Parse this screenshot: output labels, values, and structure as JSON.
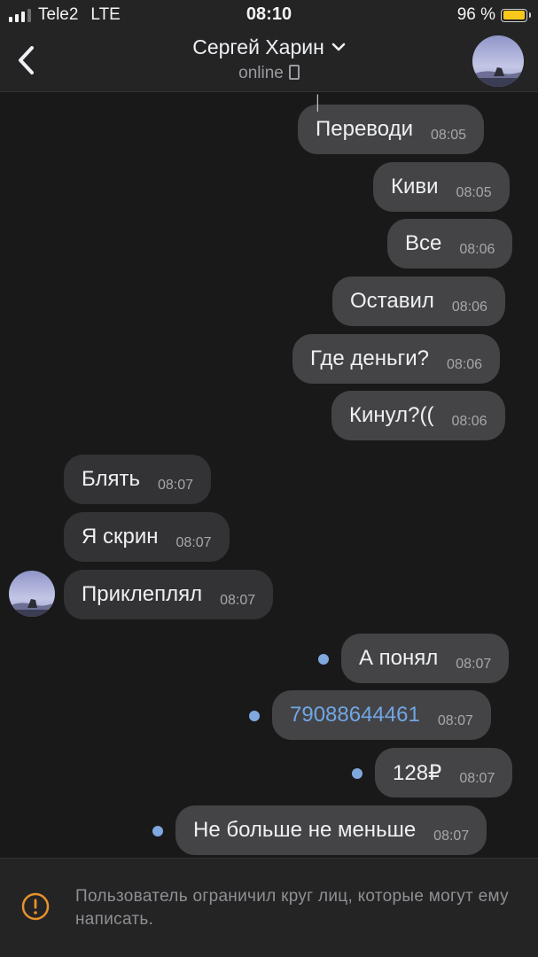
{
  "status_bar": {
    "carrier": "Tele2",
    "network": "LTE",
    "time": "08:10",
    "battery_percent": "96 %",
    "battery_level": 0.96
  },
  "header": {
    "title": "Сергей Харин",
    "status": "online",
    "back_icon": "chevron-left-icon",
    "dropdown_icon": "chevron-down-icon"
  },
  "messages": [
    {
      "text": "Переводи",
      "time": "08:05",
      "direction": "out"
    },
    {
      "text": "Киви",
      "time": "08:05",
      "direction": "out"
    },
    {
      "text": "Все",
      "time": "08:06",
      "direction": "out"
    },
    {
      "text": "Оставил",
      "time": "08:06",
      "direction": "out"
    },
    {
      "text": "Где деньги?",
      "time": "08:06",
      "direction": "out"
    },
    {
      "text": "Кинул?((",
      "time": "08:06",
      "direction": "out"
    },
    {
      "text": "Блять",
      "time": "08:07",
      "direction": "in"
    },
    {
      "text": "Я скрин",
      "time": "08:07",
      "direction": "in"
    },
    {
      "text": "Приклеплял",
      "time": "08:07",
      "direction": "in"
    },
    {
      "text": "А понял",
      "time": "08:07",
      "direction": "out",
      "unread": true
    },
    {
      "text": "79088644461",
      "time": "08:07",
      "direction": "out",
      "unread": true,
      "is_link": true
    },
    {
      "text": "128₽",
      "time": "08:07",
      "direction": "out",
      "unread": true
    },
    {
      "text": "Не больше не меньше",
      "time": "08:07",
      "direction": "out",
      "unread": true
    }
  ],
  "restriction": {
    "icon": "warning-icon",
    "text": "Пользователь ограничил круг лиц, которые могут ему написать."
  },
  "colors": {
    "background": "#19191a",
    "bar": "#242425",
    "bubble_out": "#444446",
    "bubble_in": "#333335",
    "link": "#71a6e6",
    "unread_dot": "#7fa9de",
    "warning": "#e8912c",
    "battery": "#f7c81a"
  }
}
